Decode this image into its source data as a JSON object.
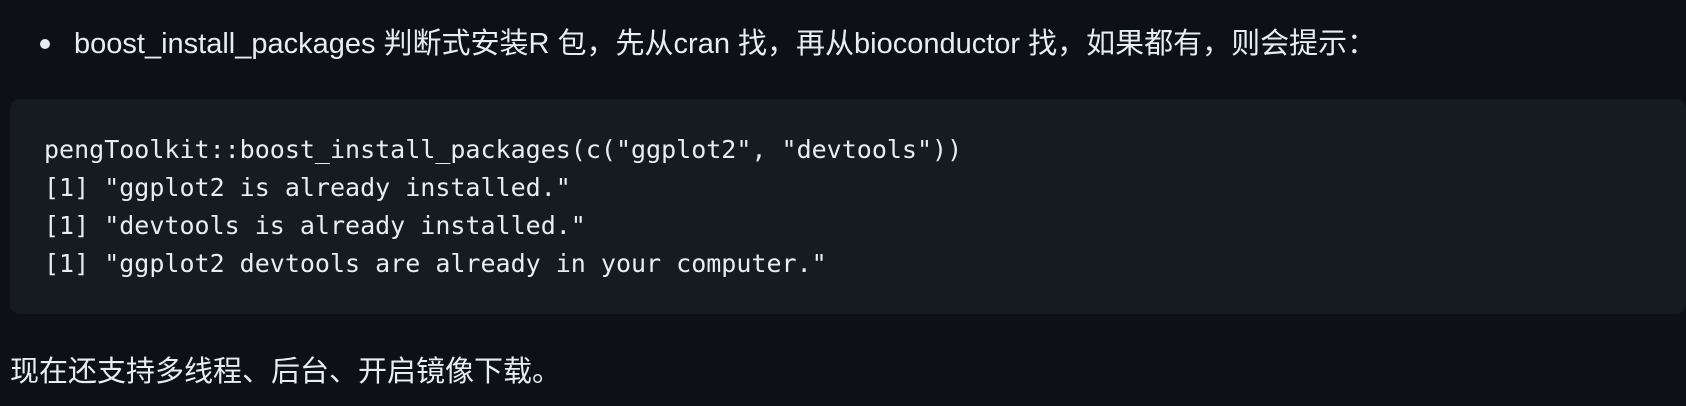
{
  "bullet": {
    "text": "boost_install_packages 判断式安装R 包，先从cran 找，再从bioconductor 找，如果都有，则会提示："
  },
  "code": {
    "lines": [
      "pengToolkit::boost_install_packages(c(\"ggplot2\", \"devtools\"))",
      "[1] \"ggplot2 is already installed.\"",
      "[1] \"devtools is already installed.\"",
      "[1] \"ggplot2 devtools are already in your computer.\""
    ]
  },
  "paragraph": {
    "text": "现在还支持多线程、后台、开启镜像下载。"
  }
}
